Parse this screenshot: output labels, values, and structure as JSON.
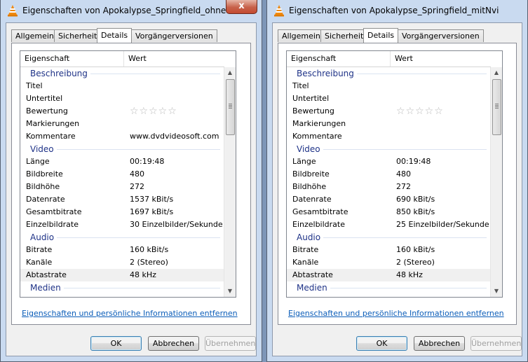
{
  "dialogs": [
    {
      "title": "Eigenschaften von Apokalypse_Springfield_ohneNvid...",
      "close_label": "x",
      "tabs": [
        "Allgemein",
        "Sicherheit",
        "Details",
        "Vorgängerversionen"
      ],
      "header": {
        "property": "Eigenschaft",
        "value": "Wert"
      },
      "groups": {
        "beschreibung": "Beschreibung",
        "video": "Video",
        "audio": "Audio",
        "medien": "Medien"
      },
      "desc": {
        "titel": "Titel",
        "untertitel": "Untertitel",
        "bewertung": "Bewertung",
        "markierungen": "Markierungen",
        "kommentare": "Kommentare",
        "kommentare_val": "www.dvdvideosoft.com",
        "stars": "☆☆☆☆☆"
      },
      "video": {
        "laenge": "Länge",
        "laenge_val": "00:19:48",
        "breite": "Bildbreite",
        "breite_val": "480",
        "hoehe": "Bildhöhe",
        "hoehe_val": "272",
        "datenrate": "Datenrate",
        "datenrate_val": "1537 kBit/s",
        "gesamt": "Gesamtbitrate",
        "gesamt_val": "1697 kBit/s",
        "einzel": "Einzelbildrate",
        "einzel_val": "30 Einzelbilder/Sekunde"
      },
      "audio": {
        "bitrate": "Bitrate",
        "bitrate_val": "160 kBit/s",
        "kanaele": "Kanäle",
        "kanaele_val": "2 (Stereo)",
        "abtast": "Abtastrate",
        "abtast_val": "48 kHz"
      },
      "link": "Eigenschaften und persönliche Informationen entfernen",
      "buttons": {
        "ok": "OK",
        "cancel": "Abbrechen",
        "apply": "Übernehmen"
      }
    },
    {
      "title": "Eigenschaften von Apokalypse_Springfield_mitNvidia...",
      "close_label": "x",
      "tabs": [
        "Allgemein",
        "Sicherheit",
        "Details",
        "Vorgängerversionen"
      ],
      "header": {
        "property": "Eigenschaft",
        "value": "Wert"
      },
      "groups": {
        "beschreibung": "Beschreibung",
        "video": "Video",
        "audio": "Audio",
        "medien": "Medien"
      },
      "desc": {
        "titel": "Titel",
        "untertitel": "Untertitel",
        "bewertung": "Bewertung",
        "markierungen": "Markierungen",
        "kommentare": "Kommentare",
        "kommentare_val": "",
        "stars": "☆☆☆☆☆"
      },
      "video": {
        "laenge": "Länge",
        "laenge_val": "00:19:48",
        "breite": "Bildbreite",
        "breite_val": "480",
        "hoehe": "Bildhöhe",
        "hoehe_val": "272",
        "datenrate": "Datenrate",
        "datenrate_val": "690 kBit/s",
        "gesamt": "Gesamtbitrate",
        "gesamt_val": "850 kBit/s",
        "einzel": "Einzelbildrate",
        "einzel_val": "25 Einzelbilder/Sekunde"
      },
      "audio": {
        "bitrate": "Bitrate",
        "bitrate_val": "160 kBit/s",
        "kanaele": "Kanäle",
        "kanaele_val": "2 (Stereo)",
        "abtast": "Abtastrate",
        "abtast_val": "48 kHz"
      },
      "link": "Eigenschaften und persönliche Informationen entfernen",
      "buttons": {
        "ok": "OK",
        "cancel": "Abbrechen",
        "apply": "Übernehmen"
      }
    }
  ]
}
